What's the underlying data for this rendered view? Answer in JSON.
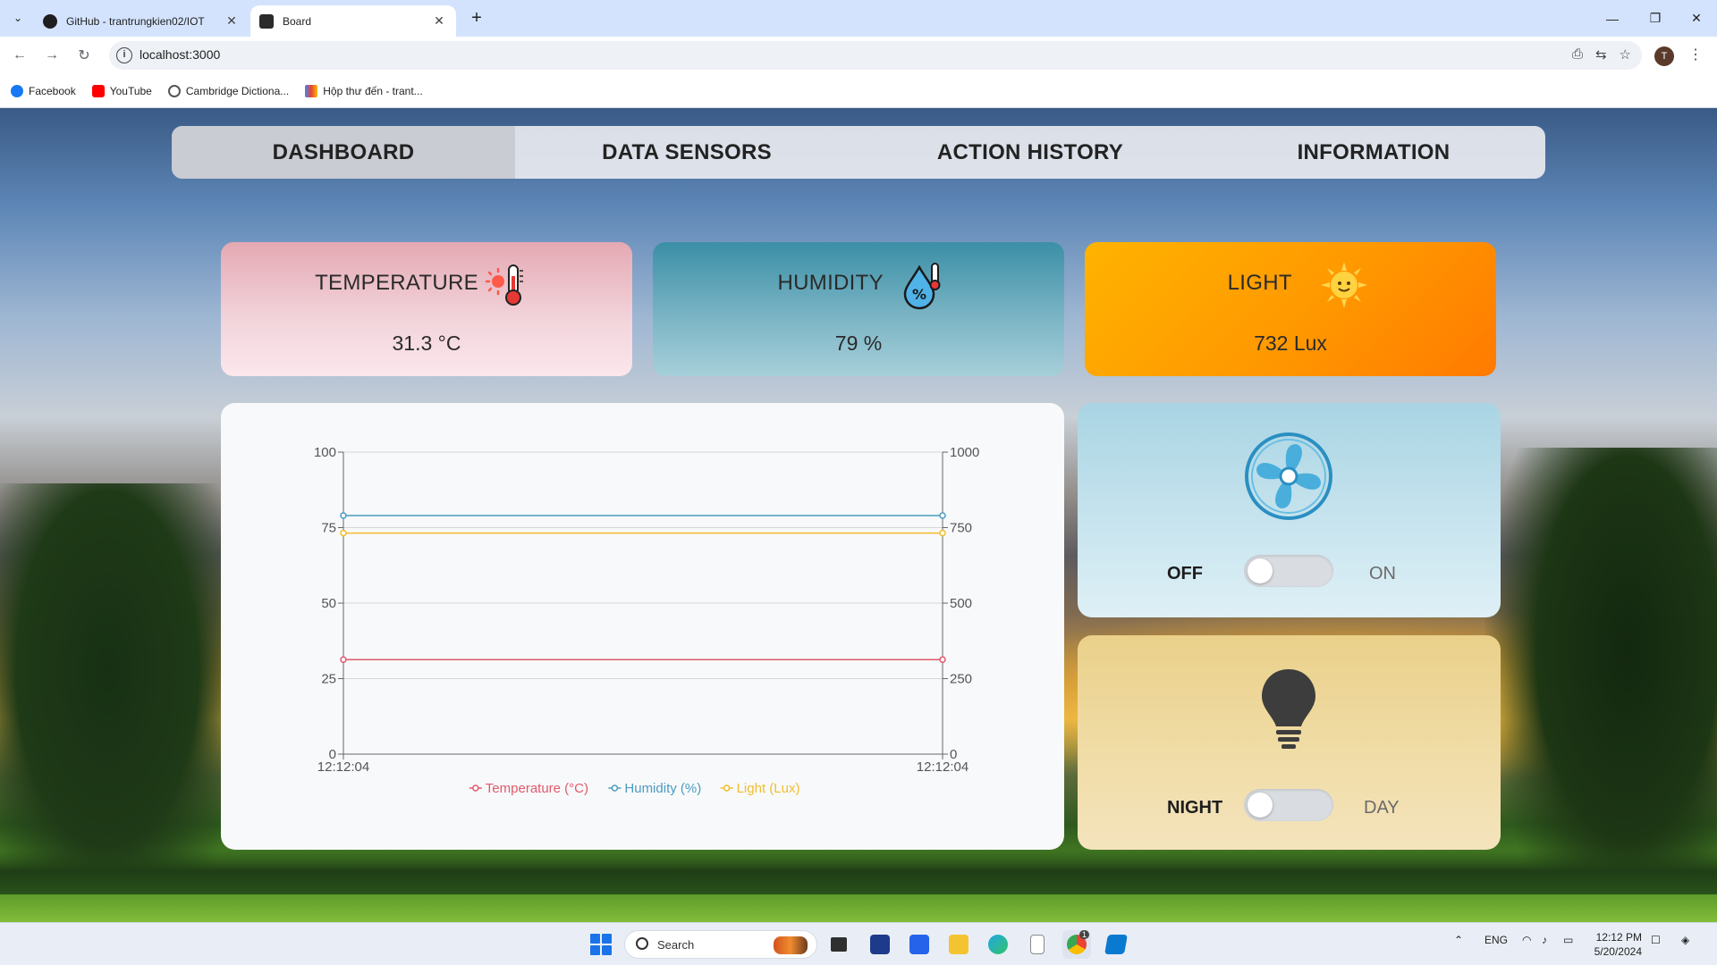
{
  "browser": {
    "tabs": [
      {
        "title": "GitHub - trantrungkien02/IOT",
        "active": false,
        "icon": "github-icon"
      },
      {
        "title": "Board",
        "active": true,
        "icon": "react-icon"
      }
    ],
    "url": "localhost:3000",
    "profile_initial": "T",
    "bookmarks": [
      {
        "label": "Facebook",
        "icon": "facebook-icon"
      },
      {
        "label": "YouTube",
        "icon": "youtube-icon"
      },
      {
        "label": "Cambridge Dictiona...",
        "icon": "globe-icon"
      },
      {
        "label": "Hộp thư đến - trant...",
        "icon": "gmail-icon"
      }
    ]
  },
  "nav": {
    "items": [
      {
        "label": "DASHBOARD",
        "active": true
      },
      {
        "label": "DATA SENSORS",
        "active": false
      },
      {
        "label": "ACTION HISTORY",
        "active": false
      },
      {
        "label": "INFORMATION",
        "active": false
      }
    ]
  },
  "cards": {
    "temperature": {
      "title": "TEMPERATURE",
      "value": "31.3 °C",
      "icon": "thermometer-icon"
    },
    "humidity": {
      "title": "HUMIDITY",
      "value": "79 %",
      "icon": "humidity-drop-icon"
    },
    "light": {
      "title": "LIGHT",
      "value": "732 Lux",
      "icon": "sun-icon"
    }
  },
  "chart_data": {
    "type": "line",
    "x": [
      "12:12:04",
      "12:12:04"
    ],
    "left_axis": {
      "ticks": [
        "0",
        "25",
        "50",
        "75",
        "100"
      ],
      "ylim": [
        0,
        100
      ]
    },
    "right_axis": {
      "ticks": [
        "0",
        "250",
        "500",
        "750",
        "1000"
      ],
      "ylim": [
        0,
        1000
      ]
    },
    "series": [
      {
        "name": "Temperature (°C)",
        "axis": "left",
        "values": [
          31.3,
          31.3
        ],
        "color": "#e05a6a"
      },
      {
        "name": "Humidity (%)",
        "axis": "left",
        "values": [
          79,
          79
        ],
        "color": "#4a9bbf"
      },
      {
        "name": "Light (Lux)",
        "axis": "right",
        "values": [
          732,
          732
        ],
        "color": "#f2bd2a"
      }
    ],
    "grid": true,
    "legend_position": "bottom"
  },
  "devices": {
    "fan": {
      "icon": "fan-icon",
      "off_label": "OFF",
      "on_label": "ON",
      "state": "off"
    },
    "lamp": {
      "icon": "lightbulb-icon",
      "off_label": "NIGHT",
      "on_label": "DAY",
      "state": "off"
    }
  },
  "taskbar": {
    "search_placeholder": "Search",
    "language": "ENG",
    "time": "12:12 PM",
    "date": "5/20/2024",
    "chrome_badge": "1"
  }
}
